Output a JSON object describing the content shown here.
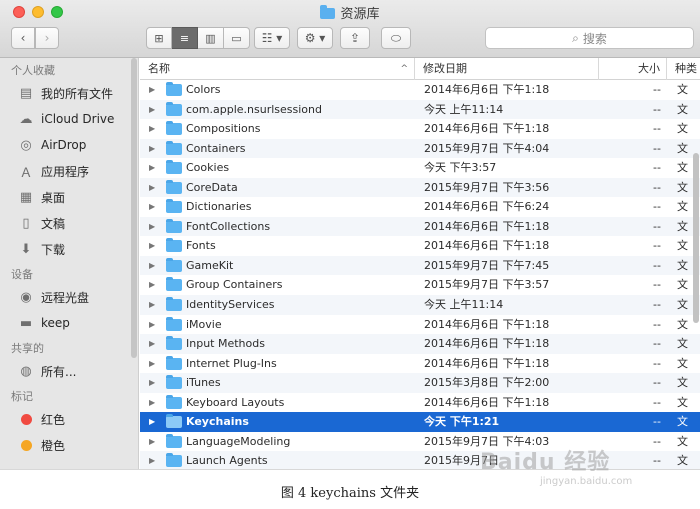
{
  "window": {
    "title": "资源库"
  },
  "toolbar": {
    "back_icon": "chevron-left-icon",
    "forward_icon": "chevron-right-icon",
    "search_placeholder": "搜索"
  },
  "sidebar": {
    "favorites_header": "个人收藏",
    "favorites": [
      {
        "label": "我的所有文件",
        "icon": "all-files-icon"
      },
      {
        "label": "iCloud Drive",
        "icon": "cloud-icon"
      },
      {
        "label": "AirDrop",
        "icon": "airdrop-icon"
      },
      {
        "label": "应用程序",
        "icon": "applications-icon"
      },
      {
        "label": "桌面",
        "icon": "desktop-icon"
      },
      {
        "label": "文稿",
        "icon": "documents-icon"
      },
      {
        "label": "下载",
        "icon": "downloads-icon"
      }
    ],
    "devices_header": "设备",
    "devices": [
      {
        "label": "远程光盘",
        "icon": "disc-icon"
      },
      {
        "label": "keep",
        "icon": "disk-icon"
      }
    ],
    "shared_header": "共享的",
    "shared": [
      {
        "label": "所有...",
        "icon": "network-icon"
      }
    ],
    "tags_header": "标记",
    "tags": [
      {
        "label": "红色",
        "color": "#f04a41"
      },
      {
        "label": "橙色",
        "color": "#f5a623"
      }
    ]
  },
  "list": {
    "columns": {
      "name": "名称",
      "date": "修改日期",
      "size": "大小",
      "kind": "种类"
    },
    "rows": [
      {
        "name": "Colors",
        "date": "2014年6月6日 下午1:18",
        "size": "--",
        "kind": "文"
      },
      {
        "name": "com.apple.nsurlsessiond",
        "date": "今天 上午11:14",
        "size": "--",
        "kind": "文"
      },
      {
        "name": "Compositions",
        "date": "2014年6月6日 下午1:18",
        "size": "--",
        "kind": "文"
      },
      {
        "name": "Containers",
        "date": "2015年9月7日 下午4:04",
        "size": "--",
        "kind": "文"
      },
      {
        "name": "Cookies",
        "date": "今天 下午3:57",
        "size": "--",
        "kind": "文"
      },
      {
        "name": "CoreData",
        "date": "2015年9月7日 下午3:56",
        "size": "--",
        "kind": "文"
      },
      {
        "name": "Dictionaries",
        "date": "2014年6月6日 下午6:24",
        "size": "--",
        "kind": "文"
      },
      {
        "name": "FontCollections",
        "date": "2014年6月6日 下午1:18",
        "size": "--",
        "kind": "文"
      },
      {
        "name": "Fonts",
        "date": "2014年6月6日 下午1:18",
        "size": "--",
        "kind": "文"
      },
      {
        "name": "GameKit",
        "date": "2015年9月7日 下午7:45",
        "size": "--",
        "kind": "文"
      },
      {
        "name": "Group Containers",
        "date": "2015年9月7日 下午3:57",
        "size": "--",
        "kind": "文"
      },
      {
        "name": "IdentityServices",
        "date": "今天 上午11:14",
        "size": "--",
        "kind": "文"
      },
      {
        "name": "iMovie",
        "date": "2014年6月6日 下午1:18",
        "size": "--",
        "kind": "文"
      },
      {
        "name": "Input Methods",
        "date": "2014年6月6日 下午1:18",
        "size": "--",
        "kind": "文"
      },
      {
        "name": "Internet Plug-Ins",
        "date": "2014年6月6日 下午1:18",
        "size": "--",
        "kind": "文"
      },
      {
        "name": "iTunes",
        "date": "2015年3月8日 下午2:00",
        "size": "--",
        "kind": "文"
      },
      {
        "name": "Keyboard Layouts",
        "date": "2014年6月6日 下午1:18",
        "size": "--",
        "kind": "文"
      },
      {
        "name": "Keychains",
        "date": "今天 下午1:21",
        "size": "--",
        "kind": "文",
        "selected": true
      },
      {
        "name": "LanguageModeling",
        "date": "2015年9月7日 下午4:03",
        "size": "--",
        "kind": "文"
      },
      {
        "name": "Launch Agents",
        "date": "2015年9月7日",
        "size": "--",
        "kind": "文"
      }
    ]
  },
  "caption": "图 4  keychains 文件夹",
  "watermark": {
    "main": "Baidu 经验",
    "sub": "jingyan.baidu.com"
  }
}
